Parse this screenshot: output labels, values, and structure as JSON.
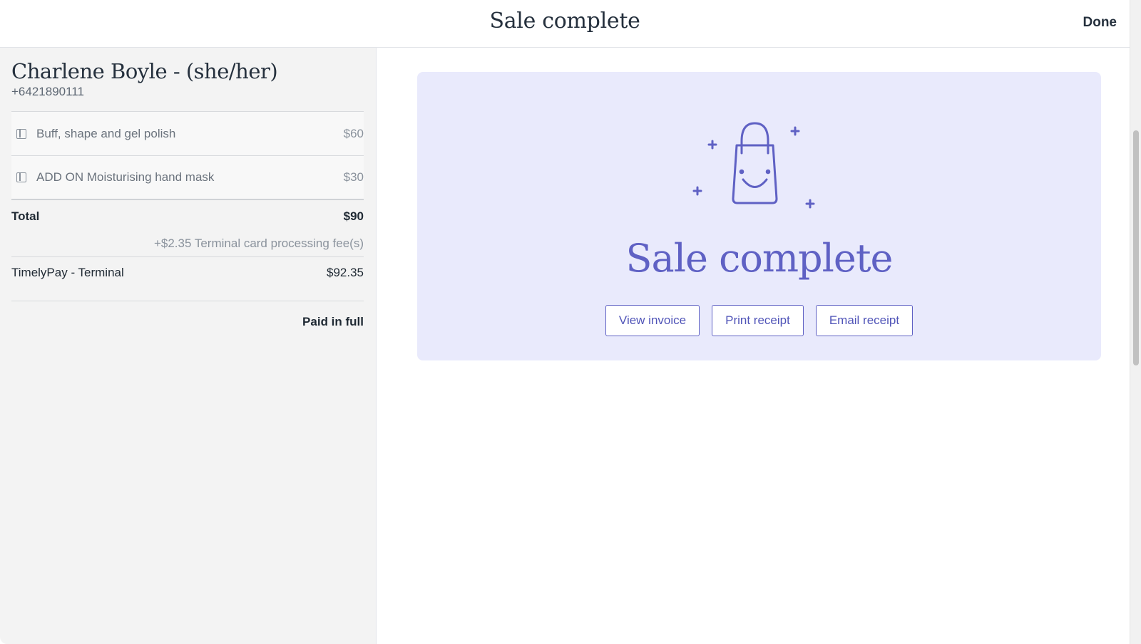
{
  "header": {
    "title": "Sale complete",
    "done_label": "Done"
  },
  "client": {
    "name": "Charlene Boyle - (she/her)",
    "phone": "+6421890111"
  },
  "items": [
    {
      "name": "Buff, shape and gel polish",
      "price": "$60"
    },
    {
      "name": "ADD ON Moisturising hand mask",
      "price": "$30"
    }
  ],
  "summary": {
    "total_label": "Total",
    "total_value": "$90",
    "fee": "+$2.35 Terminal card processing fee(s)",
    "payment_method": "TimelyPay - Terminal",
    "payment_amount": "$92.35",
    "status": "Paid in full"
  },
  "card": {
    "title": "Sale complete",
    "illustration": "shopping-bag-smile-icon",
    "accent_color": "#5f61c4",
    "background_color": "#e9eafc",
    "buttons": {
      "view_invoice": "View invoice",
      "print_receipt": "Print receipt",
      "email_receipt": "Email receipt"
    }
  }
}
